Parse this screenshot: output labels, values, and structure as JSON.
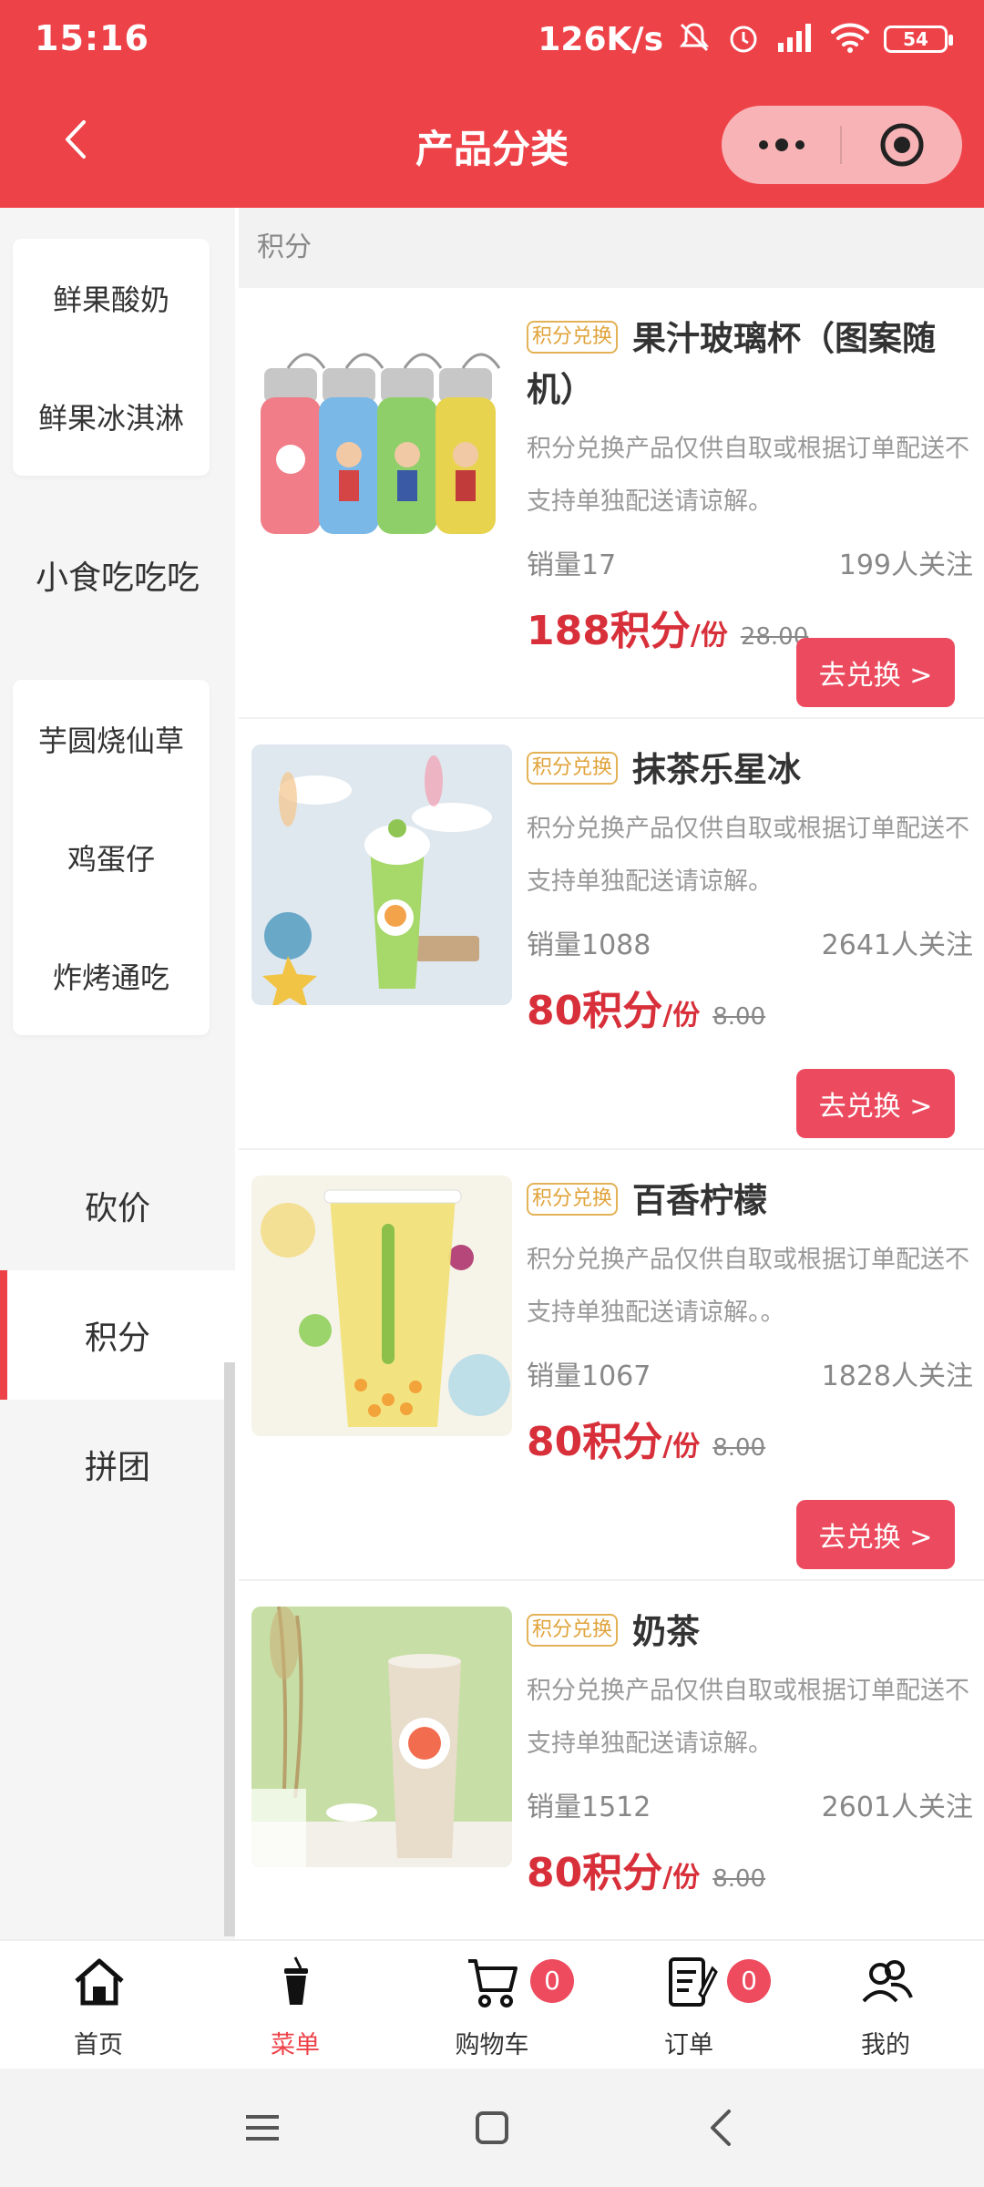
{
  "status_bar": {
    "time": "15:16",
    "speed": "126K/s",
    "battery": "54"
  },
  "nav": {
    "title": "产品分类"
  },
  "sidebar": {
    "group1": [
      "鲜果酸奶",
      "鲜果冰淇淋"
    ],
    "category_snack": "小食吃吃吃",
    "group2": [
      "芋圆烧仙草",
      "鸡蛋仔",
      "炸烤通吃"
    ],
    "category_bargain": "砍价",
    "category_points": "积分",
    "category_group": "拼团"
  },
  "content": {
    "section_title": "积分",
    "tag_label": "积分兑换",
    "price_unit": "/份",
    "exchange_label": "去兑换 >",
    "products": [
      {
        "title": "果汁玻璃杯（图案随机）",
        "desc": "积分兑换产品仅供自取或根据订单配送不支持单独配送请谅解。",
        "sales": "销量17",
        "followers": "199人关注",
        "price": "188积分",
        "old_price": "28.00"
      },
      {
        "title": "抹茶乐星冰",
        "desc": "积分兑换产品仅供自取或根据订单配送不支持单独配送请谅解。",
        "sales": "销量1088",
        "followers": "2641人关注",
        "price": "80积分",
        "old_price": "8.00"
      },
      {
        "title": "百香柠檬",
        "desc": "积分兑换产品仅供自取或根据订单配送不支持单独配送请谅解。。",
        "sales": "销量1067",
        "followers": "1828人关注",
        "price": "80积分",
        "old_price": "8.00"
      },
      {
        "title": "奶茶",
        "desc": "积分兑换产品仅供自取或根据订单配送不支持单独配送请谅解。",
        "sales": "销量1512",
        "followers": "2601人关注",
        "price": "80积分",
        "old_price": "8.00"
      }
    ]
  },
  "tabbar": {
    "home": "首页",
    "menu": "菜单",
    "cart": "购物车",
    "cart_count": "0",
    "orders": "订单",
    "orders_count": "0",
    "mine": "我的"
  },
  "colors": {
    "brand": "#ee4249",
    "button": "#ec4b5f",
    "tag": "#e0a33a"
  }
}
